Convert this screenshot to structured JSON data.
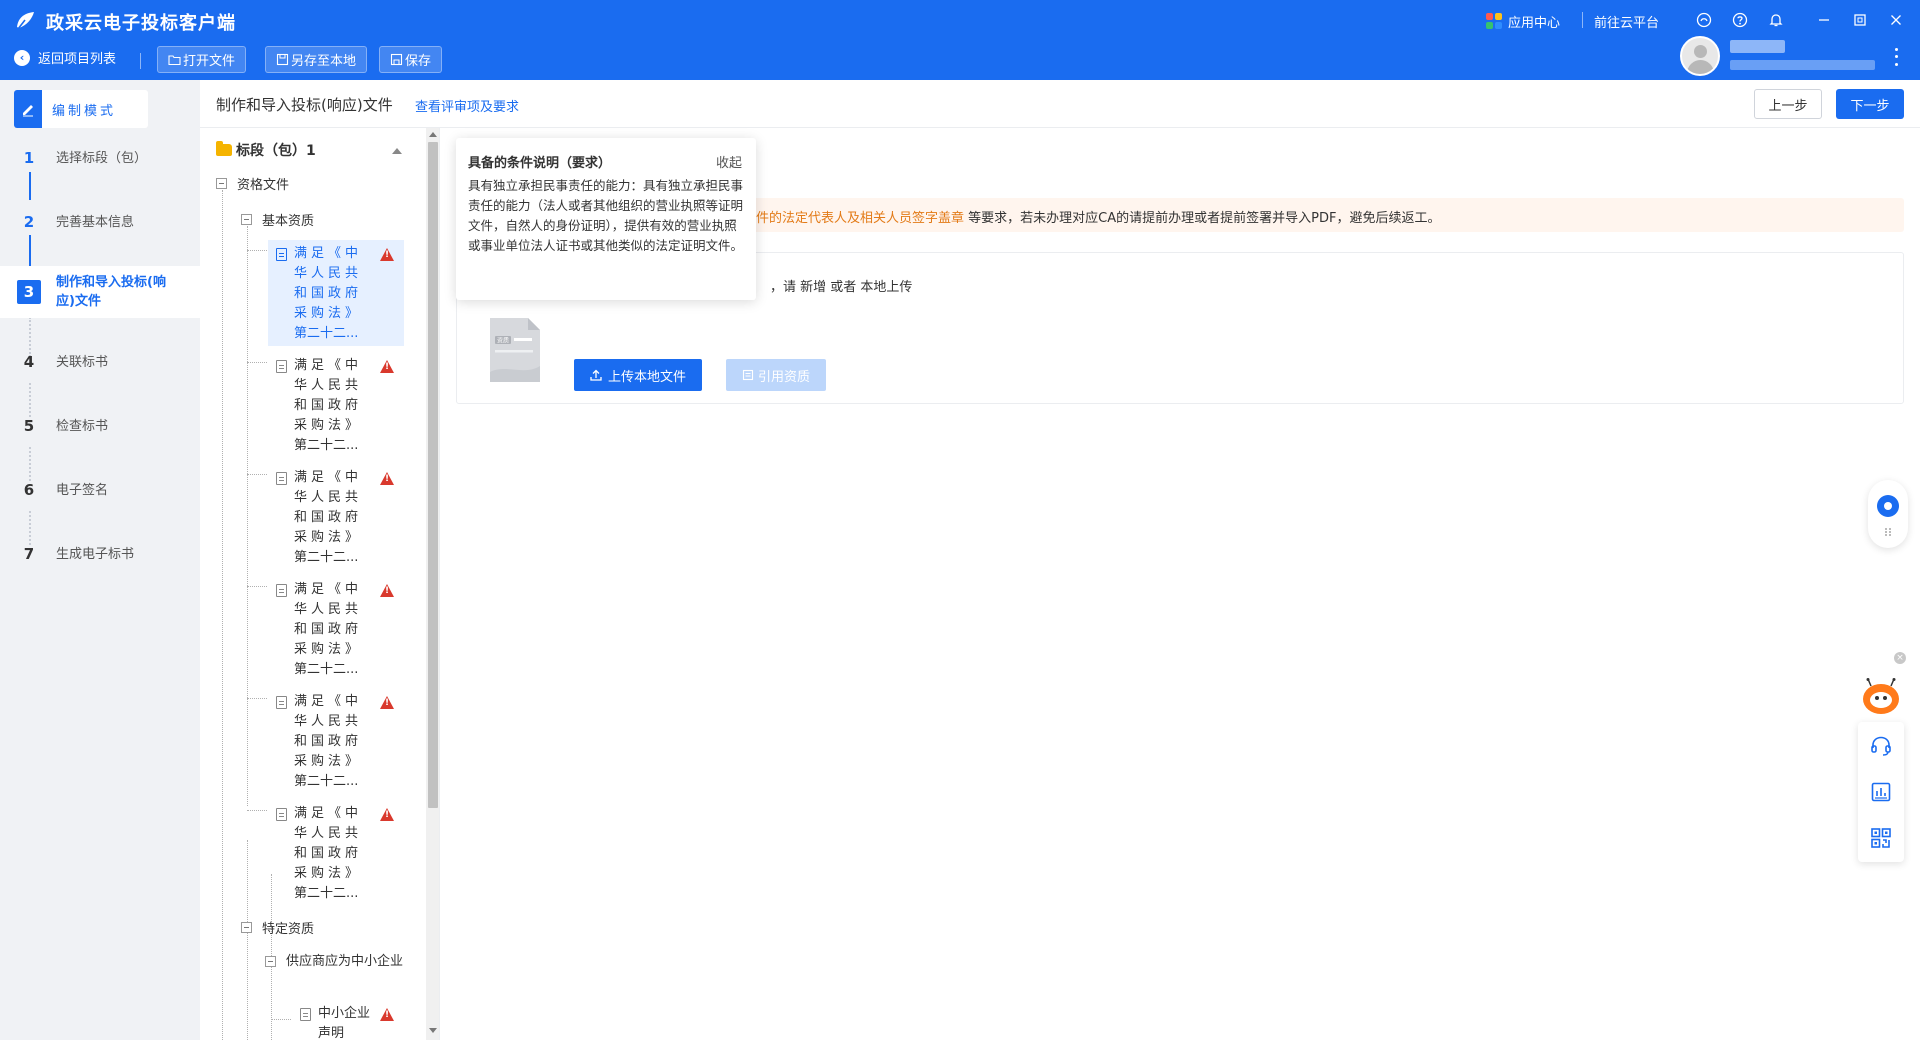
{
  "app": {
    "title": "政采云电子投标客户端",
    "app_center": "应用中心",
    "goto_cloud": "前往云平台"
  },
  "toolbar": {
    "back": "返回项目列表",
    "open_file": "打开文件",
    "save_local": "另存至本地",
    "save": "保存"
  },
  "mode": {
    "label": "编制模式"
  },
  "steps": [
    {
      "num": "1",
      "label": "选择标段（包）"
    },
    {
      "num": "2",
      "label": "完善基本信息"
    },
    {
      "num": "3",
      "label": "制作和导入投标(响应)文件"
    },
    {
      "num": "4",
      "label": "关联标书"
    },
    {
      "num": "5",
      "label": "检查标书"
    },
    {
      "num": "6",
      "label": "电子签名"
    },
    {
      "num": "7",
      "label": "生成电子标书"
    }
  ],
  "header": {
    "title": "制作和导入投标(响应)文件",
    "review_link": "查看评审项及要求",
    "prev": "上一步",
    "next": "下一步"
  },
  "tree": {
    "root": "标段（包）1",
    "qualification": "资格文件",
    "basic": "基本资质",
    "doc_items": [
      {
        "text": "满足《中华人民共和国政府采购法》",
        "tail": "第二十二..."
      },
      {
        "text": "满足《中华人民共和国政府采购法》",
        "tail": "第二十二..."
      },
      {
        "text": "满足《中华人民共和国政府采购法》",
        "tail": "第二十二..."
      },
      {
        "text": "满足《中华人民共和国政府采购法》",
        "tail": "第二十二..."
      },
      {
        "text": "满足《中华人民共和国政府采购法》",
        "tail": "第二十二..."
      },
      {
        "text": "满足《中华人民共和国政府采购法》",
        "tail": "第二十二..."
      }
    ],
    "specific": "特定资质",
    "sme": "供应商应为中小企业",
    "sme_decl": "中小企业声明"
  },
  "notice": {
    "highlight": "件的法定代表人及相关人员签字盖章",
    "rest": " 等要求，若未办理对应CA的请提前办理或者提前签署并导入PDF，避免后续返工。"
  },
  "upload": {
    "hint": "，请 新增 或者 本地上传",
    "illus_tag": "资质",
    "upload_btn": "上传本地文件",
    "cite_btn": "引用资质"
  },
  "popover": {
    "title": "具备的条件说明（要求）",
    "close": "收起",
    "body": "具有独立承担民事责任的能力：具有独立承担民事责任的能力（法人或者其他组织的营业执照等证明文件，自然人的身份证明），提供有效的营业执照或事业单位法人证书或其他类似的法定证明文件。"
  },
  "colors": {
    "brand": "#1a6cf0",
    "warning": "#d9392d",
    "notice_highlight": "#e37b18"
  }
}
